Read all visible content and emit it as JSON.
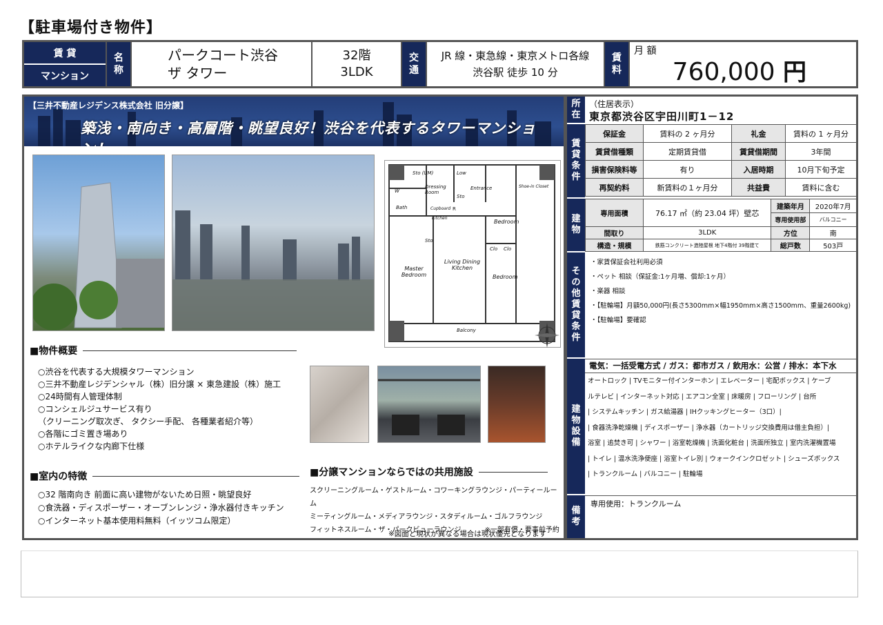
{
  "page_title": "【駐車場付き物件】",
  "header": {
    "type_top": "賃 貸",
    "type_bottom": "マンション",
    "name_label": [
      "名",
      "称"
    ],
    "name_lines": [
      "パークコート渋谷",
      "ザ タワー"
    ],
    "floor": "32階",
    "layout": "3LDK",
    "traffic_label": [
      "交",
      "通"
    ],
    "traffic_lines": [
      "JR 線・東急線・東京メトロ各線",
      "渋谷駅 徒歩 10 分"
    ],
    "rent_label": [
      "賃",
      "料"
    ],
    "rent_sub": "月 額",
    "rent_value": "760,000",
    "rent_unit": "円"
  },
  "banner": {
    "tag": "【三井不動産レジデンス株式会社 旧分譲】",
    "title": "築浅・南向き・高層階・眺望良好！渋谷を代表するタワーマンション！"
  },
  "floorplan": {
    "rooms": [
      "Sto (UM)",
      "Low",
      "W",
      "Dressing Room",
      "Sto",
      "Entrance",
      "Shoe-in Closet",
      "Bath",
      "Cupboard",
      "Kitchen",
      "R",
      "Bedroom",
      "Sto",
      "Living Dining Kitchen",
      "Clo",
      "Clo",
      "Master Bedroom",
      "Bedroom",
      "Balcony"
    ]
  },
  "overview": {
    "heading": "■物件概要",
    "items": [
      "○渋谷を代表する大規模タワーマンション",
      "○三井不動産レジデンシャル（株）旧分譲 × 東急建設（株）施工",
      "○24時間有人管理体制",
      "○コンシェルジュサービス有り",
      "（クリーニング取次ぎ、 タクシー手配、 各種業者紹介等）",
      "○各階にゴミ置き場あり",
      "○ホテルライクな内廊下仕様"
    ]
  },
  "interior": {
    "heading": "■室内の特徴",
    "items": [
      "○32 階南向き  前面に高い建物がないため日照・眺望良好",
      "○食洗器・ディスポーザー・オーブンレンジ・浄水器付きキッチン",
      "○インターネット基本使用料無料（イッツコム限定）"
    ]
  },
  "facilities": {
    "heading": "■分譲マンションならではの共用施設",
    "lines": [
      "スクリーニングルーム・ゲストルーム・コワーキングラウンジ・パーティールーム",
      "ミーティングルーム・メディアラウンジ・スタディルーム・ゴルフラウンジ",
      "フィットネスルーム・ザ・パークビューラウンジ"
    ],
    "note_fee": "※一部有償・要事前予約",
    "note_plan": "※図面と現状が異なる場合は現状優先となります"
  },
  "address": {
    "label": [
      "所",
      "在"
    ],
    "small": "（住居表示）",
    "value": "東京都渋谷区宇田川町1－12"
  },
  "terms": {
    "label": [
      "賃",
      "貸",
      "条",
      "件"
    ],
    "rows": [
      [
        "保証金",
        "賃料の 2 ヶ月分",
        "礼金",
        "賃料の 1 ヶ月分"
      ],
      [
        "賃貸借種類",
        "定期賃貸借",
        "賃貸借期間",
        "3年間"
      ],
      [
        "損害保険料等",
        "有り",
        "入居時期",
        "10月下旬予定"
      ],
      [
        "再契約料",
        "新賃料の１ヶ月分",
        "共益費",
        "賃料に含む"
      ]
    ]
  },
  "building": {
    "label": [
      "建",
      "物"
    ],
    "area_label": "専用面積",
    "area_value": "76.17 ㎡（約 23.04 坪）壁芯",
    "built_label": "建築年月",
    "built_value": "2020年7月",
    "private_label": "専用使用部",
    "private_value": "バルコニー",
    "layout_label": "間取り",
    "layout_value": "3LDK",
    "direction_label": "方位",
    "direction_value": "南",
    "structure_label": "構造・規模",
    "structure_value": "鉄筋コンクリート造陸屋根 地下4階付 39階建て",
    "units_label": "総戸数",
    "units_value": "503戸"
  },
  "other": {
    "label": [
      "そ",
      "の",
      "他",
      "賃",
      "貸",
      "条",
      "件"
    ],
    "items": [
      "・家賃保証会社利用必須",
      "・ペット 相談（保証金:1ヶ月増、償却:1ヶ月）",
      "・楽器 相談",
      "・【駐輪場】月額50,000円(長さ5300mm×幅1950mm×高さ1500mm、重量2600kg)",
      "・【駐輪場】要確認"
    ]
  },
  "equipment": {
    "label": [
      "建",
      "物",
      "設",
      "備"
    ],
    "utilities": "電気：一括受電方式 / ガス：都市ガス / 飲用水：公営 / 排水：本下水",
    "lines": [
      "オートロック | TVモニター付インターホン | エレベーター | 宅配ボックス | ケーブ",
      "ルテレビ | インターネット対応 | エアコン全室  | 床暖房 | フローリング | 台所",
      "| システムキッチン | ガス給湯器 | IHクッキングヒーター（3口）|",
      "| 食器洗浄乾燥機 | ディスポーザー | 浄水器（カートリッジ交換費用は借主負担）|",
      "浴室 | 追焚き可 | シャワー | 浴室乾燥機 | 洗面化粧台 | 洗面所独立 | 室内洗濯機置場",
      "| トイレ | 温水洗浄便座 | 浴室トイレ別 | ウォークインクロゼット | シューズボックス",
      "| トランクルーム | バルコニー | 駐輪場"
    ]
  },
  "remarks": {
    "label": [
      "備",
      "考"
    ],
    "value": "専用使用：トランクルーム"
  },
  "colors": {
    "navy": "#16285a",
    "border": "#555555",
    "label_bg": "#e6e6e6"
  }
}
